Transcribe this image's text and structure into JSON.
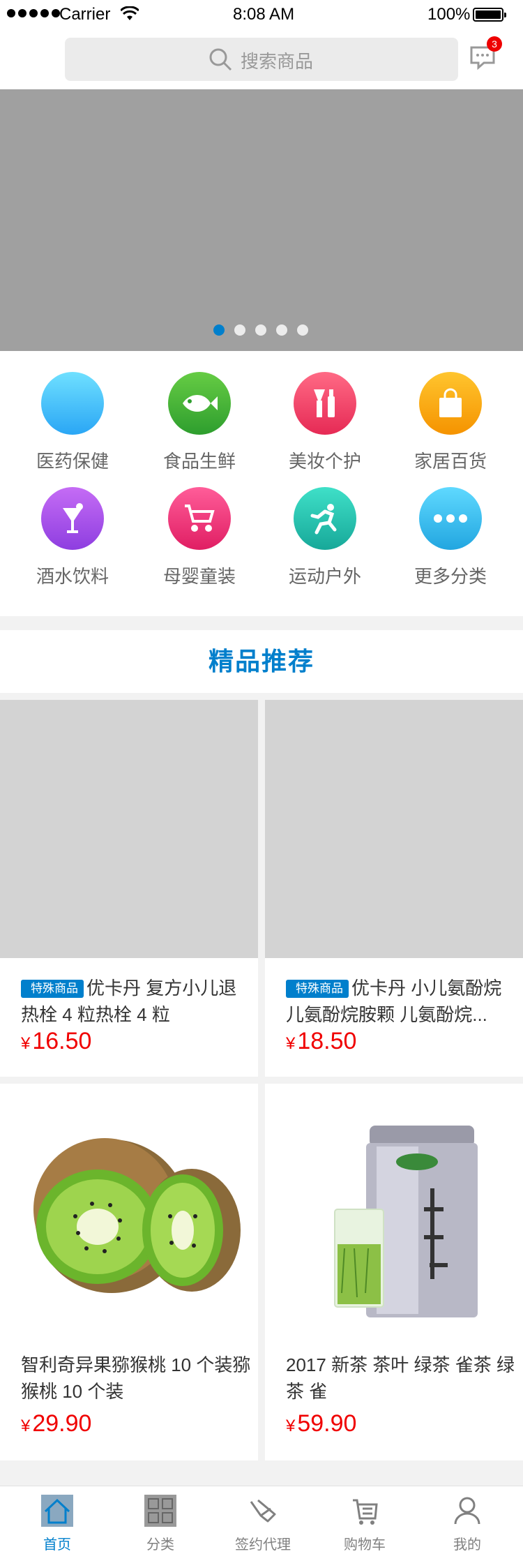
{
  "status_bar": {
    "carrier": "Carrier",
    "time": "8:08 AM",
    "battery": "100%"
  },
  "search": {
    "placeholder": "搜索商品",
    "icon": "search-icon",
    "message_icon": "message-icon",
    "badge": "3"
  },
  "banner": {
    "dots": 5,
    "active_dot": 0,
    "active_color": "#007FCC"
  },
  "categories": [
    {
      "label": "医药保健",
      "icon": "pill-icon",
      "color": "#40c4ff"
    },
    {
      "label": "食品生鲜",
      "icon": "fish-icon",
      "color": "#4caf50"
    },
    {
      "label": "美妆个护",
      "icon": "cosmetics-icon",
      "color": "#f44369"
    },
    {
      "label": "家居百货",
      "icon": "shopping-bag-icon",
      "color": "#ffb300"
    },
    {
      "label": "酒水饮料",
      "icon": "drink-icon",
      "color": "#ab47f0"
    },
    {
      "label": "母婴童装",
      "icon": "stroller-icon",
      "color": "#f5407a"
    },
    {
      "label": "运动户外",
      "icon": "running-icon",
      "color": "#26c6b0"
    },
    {
      "label": "更多分类",
      "icon": "more-icon",
      "color": "#3ac4f0"
    }
  ],
  "section": {
    "title": "精品推荐"
  },
  "products": [
    {
      "tag": "特殊商品",
      "name": "优卡丹 复方小儿退热栓 4 粒热栓 4 粒",
      "currency": "¥",
      "price": "16.50"
    },
    {
      "tag": "特殊商品",
      "name": "优卡丹 小儿氨酚烷 儿氨酚烷胺颗 儿氨酚烷...",
      "currency": "¥",
      "price": "18.50"
    },
    {
      "tag": "",
      "name": "智利奇异果猕猴桃 10 个装猕猴桃 10 个装",
      "currency": "¥",
      "price": "29.90"
    },
    {
      "tag": "",
      "name": "2017 新茶 茶叶 绿茶 雀茶 绿茶 雀",
      "currency": "¥",
      "price": "59.90"
    }
  ],
  "tabbar": [
    {
      "label": "首页",
      "icon": "home-icon",
      "active": true
    },
    {
      "label": "分类",
      "icon": "category-grid-icon",
      "active": false
    },
    {
      "label": "签约代理",
      "icon": "handshake-icon",
      "active": false
    },
    {
      "label": "购物车",
      "icon": "cart-icon",
      "active": false
    },
    {
      "label": "我的",
      "icon": "user-icon",
      "active": false
    }
  ]
}
